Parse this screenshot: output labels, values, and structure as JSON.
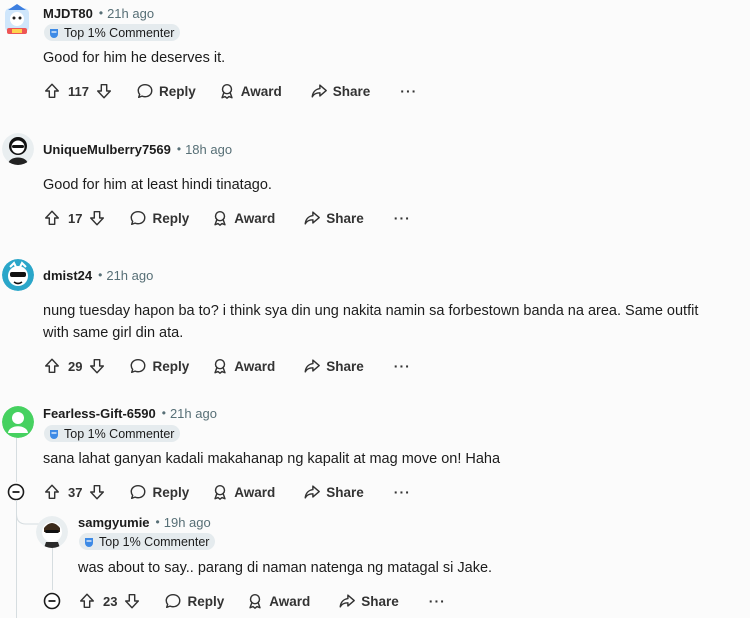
{
  "comments": [
    {
      "username": "MJDT80",
      "time": "21h ago",
      "badge": "Top 1% Commenter",
      "text": "Good for him he deserves it.",
      "votes": "117"
    },
    {
      "username": "UniqueMulberry7569",
      "time": "18h ago",
      "badge": "",
      "text": "Good for him at least hindi tinatago.",
      "votes": "17"
    },
    {
      "username": "dmist24",
      "time": "21h ago",
      "badge": "",
      "text_line1": "nung tuesday hapon ba to? i think sya din ung nakita namin sa forbestown banda na area. Same outfit",
      "text_line2": "with same girl din ata.",
      "votes": "29"
    },
    {
      "username": "Fearless-Gift-6590",
      "time": "21h ago",
      "badge": "Top 1% Commenter",
      "text": "sana lahat ganyan kadali makahanap ng kapalit at mag move on! Haha",
      "votes": "37"
    },
    {
      "username": "samgyumie",
      "time": "19h ago",
      "badge": "Top 1% Commenter",
      "text": "was about to say.. parang di naman natenga ng matagal si Jake.",
      "votes": "23"
    }
  ],
  "actions": {
    "reply": "Reply",
    "award": "Award",
    "share": "Share",
    "more": "···"
  },
  "colors": {
    "background": "#fbfbfb",
    "badge_bg": "#e5ebee",
    "muted": "#576f76"
  }
}
